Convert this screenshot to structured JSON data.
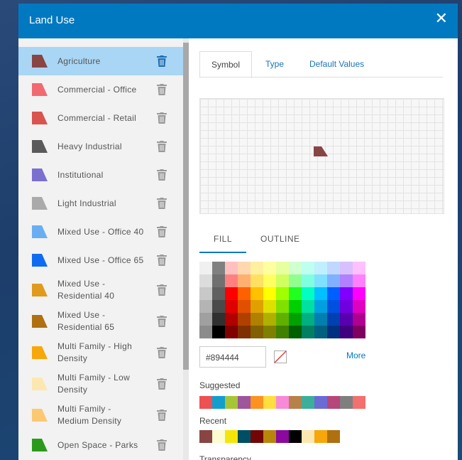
{
  "dialog": {
    "title": "Land Use"
  },
  "layers": [
    {
      "label": "Agriculture",
      "color": "#894444",
      "selected": true
    },
    {
      "label": "Commercial - Office",
      "color": "#f06a6f"
    },
    {
      "label": "Commercial - Retail",
      "color": "#d9534f"
    },
    {
      "label": "Heavy Industrial",
      "color": "#5a5a5a"
    },
    {
      "label": "Institutional",
      "color": "#7b6fd0"
    },
    {
      "label": "Light Industrial",
      "color": "#aaaaaa"
    },
    {
      "label": "Mixed Use - Office 40",
      "color": "#6aaef2"
    },
    {
      "label": "Mixed Use - Office 65",
      "color": "#0f6cf0"
    },
    {
      "label": "Mixed Use - Residential 40",
      "label_lines": [
        "Mixed Use -",
        "Residential 40"
      ],
      "color": "#e09a1c"
    },
    {
      "label": "Mixed Use - Residential 65",
      "label_lines": [
        "Mixed Use -",
        "Residential 65"
      ],
      "color": "#b07010"
    },
    {
      "label": "Multi Family - High Density",
      "label_lines": [
        "Multi Family - High",
        "Density"
      ],
      "color": "#f7a70a"
    },
    {
      "label": "Multi Family - Low Density",
      "label_lines": [
        "Multi Family - Low",
        "Density"
      ],
      "color": "#fde7b0"
    },
    {
      "label": "Multi Family - Medium Density",
      "label_lines": [
        "Multi Family -",
        "Medium Density"
      ],
      "color": "#fcc972"
    },
    {
      "label": "Open Space - Parks",
      "color": "#2a9a1a"
    }
  ],
  "tabs": {
    "symbol": "Symbol",
    "type": "Type",
    "default_values": "Default Values"
  },
  "symbol_tabs": {
    "fill": "FILL",
    "outline": "OUTLINE"
  },
  "preview_color": "#894444",
  "hex_value": "#894444",
  "more_label": "More",
  "suggested_label": "Suggested",
  "recent_label": "Recent",
  "transparency_label": "Transparency",
  "suggested_colors": [
    "#ed5151",
    "#149ece",
    "#a7c636",
    "#9e559c",
    "#fc921f",
    "#ffde3e",
    "#f789d8",
    "#b7814a",
    "#3caf99",
    "#6b6bd6",
    "#b54779",
    "#7f7f7f",
    "#f2706d"
  ],
  "recent_colors": [
    "#894444",
    "#fcfcd0",
    "#f5e60a",
    "#004e63",
    "#720606",
    "#b8860b",
    "#8a0a9e",
    "#000000",
    "#fde7b0",
    "#f7a70a",
    "#b07010"
  ],
  "palette_colors": [
    [
      "#f0f0f0",
      "#808080",
      "#ffc0c0",
      "#ffd8b0",
      "#fff0a0",
      "#ffffa0",
      "#e8ffa0",
      "#d0ffd0",
      "#c0fff0",
      "#c0f0ff",
      "#c0d8ff",
      "#d8c0ff",
      "#ffc0ff"
    ],
    [
      "#dcdcdc",
      "#707070",
      "#ff8080",
      "#ffb070",
      "#ffe060",
      "#ffff60",
      "#d0ff60",
      "#90ff90",
      "#80ffe0",
      "#80e0ff",
      "#80b0ff",
      "#b080ff",
      "#ff80ff"
    ],
    [
      "#c8c8c8",
      "#606060",
      "#ff0000",
      "#ff6000",
      "#ffc000",
      "#ffff00",
      "#a0ff00",
      "#20ff20",
      "#00ffc0",
      "#00c0ff",
      "#0060ff",
      "#8000ff",
      "#ff00ff"
    ],
    [
      "#b4b4b4",
      "#4a4a4a",
      "#e00000",
      "#e05000",
      "#e0a000",
      "#e0e000",
      "#80e000",
      "#00d000",
      "#00e0a0",
      "#00a0e0",
      "#0050e0",
      "#7000e0",
      "#e000c0"
    ],
    [
      "#a0a0a0",
      "#303030",
      "#b00000",
      "#b04000",
      "#b08000",
      "#b0b000",
      "#60b000",
      "#00a000",
      "#00b080",
      "#0080b0",
      "#0040b0",
      "#5800b0",
      "#b00090"
    ],
    [
      "#8c8c8c",
      "#000000",
      "#800000",
      "#803000",
      "#806000",
      "#808000",
      "#408000",
      "#006000",
      "#008060",
      "#006080",
      "#003080",
      "#400080",
      "#800060"
    ]
  ]
}
